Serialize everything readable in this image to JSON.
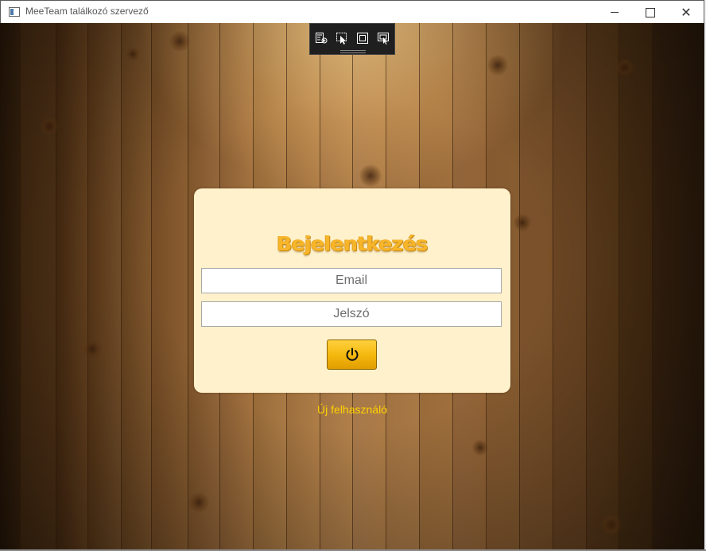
{
  "window": {
    "title": "MeeTeam találkozó szervező",
    "minimize_icon": "minimize-icon",
    "maximize_icon": "maximize-icon",
    "close_icon": "close-icon"
  },
  "dev_toolbar": {
    "tools": [
      "live-visual-tree-icon",
      "select-element-icon",
      "display-layout-adorners-icon",
      "track-focus-icon"
    ]
  },
  "login": {
    "heading": "Bejelentkezés",
    "email_placeholder": "Email",
    "password_placeholder": "Jelszó",
    "login_icon": "power-icon",
    "new_user_link": "Új felhasználó"
  },
  "colors": {
    "card_background": "#fef1cb",
    "heading_color": "#f7b52a",
    "button_color": "#f5b90f",
    "link_color": "#ffd200"
  }
}
